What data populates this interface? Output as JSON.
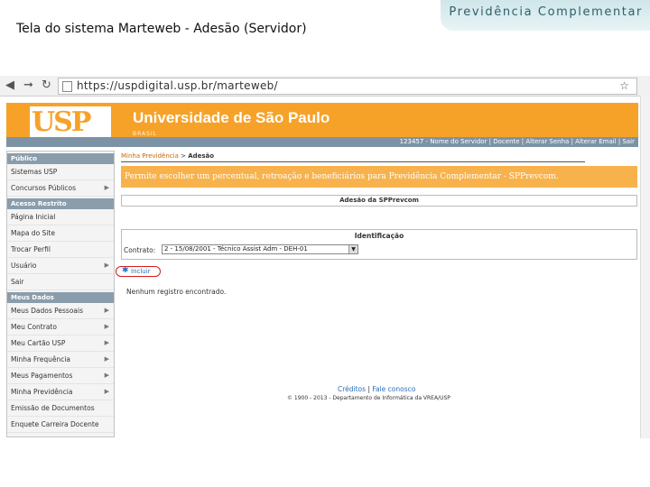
{
  "slide": {
    "banner_title": "Previdência Complementar",
    "title": "Tela do sistema Marteweb - Adesão (Servidor)"
  },
  "browser": {
    "back_icon": "back-arrow-icon",
    "forward_icon": "forward-arrow-icon",
    "reload_icon": "reload-icon",
    "url": "https://uspdigital.usp.br/marteweb/"
  },
  "header": {
    "logo_text": "USP",
    "university_name": "Universidade de São Paulo",
    "country": "BRASIL",
    "user_bar": "123457 - Nome do Servidor | Docente | Alterar Senha | Alterar Email | Sair"
  },
  "sidebar": {
    "sections": [
      {
        "heading": "Público",
        "items": [
          {
            "label": "Sistemas USP",
            "arrow": false
          },
          {
            "label": "Concursos Públicos",
            "arrow": true
          }
        ]
      },
      {
        "heading": "Acesso Restrito",
        "items": [
          {
            "label": "Página Inicial",
            "arrow": false
          },
          {
            "label": "Mapa do Site",
            "arrow": false
          },
          {
            "label": "Trocar Perfil",
            "arrow": false
          },
          {
            "label": "Usuário",
            "arrow": true
          },
          {
            "label": "Sair",
            "arrow": false
          }
        ]
      },
      {
        "heading": "Meus Dados",
        "items": [
          {
            "label": "Meus Dados Pessoais",
            "arrow": true
          },
          {
            "label": "Meu Contrato",
            "arrow": true
          },
          {
            "label": "Meu Cartão USP",
            "arrow": true
          },
          {
            "label": "Minha Frequência",
            "arrow": true
          },
          {
            "label": "Meus Pagamentos",
            "arrow": true
          },
          {
            "label": "Minha Previdência",
            "arrow": true
          },
          {
            "label": "Emissão de Documentos",
            "arrow": false
          },
          {
            "label": "Enquete Carreira Docente",
            "arrow": false
          }
        ]
      }
    ]
  },
  "main": {
    "breadcrumb_link": "Minha Previdência",
    "breadcrumb_sep": " > ",
    "breadcrumb_current": "Adesão",
    "banner_text": "Permite escolher um percentual, retroação e beneficiários para Previdência Complementar - SPPrevcom.",
    "section_title": "Adesão da SPPrevcom",
    "ident_title": "Identificação",
    "contrato_label": "Contrato:",
    "contrato_value": "2 - 15/08/2001 - Técnico Assist Adm - DEH-01",
    "incluir_label": "Incluir",
    "no_records": "Nenhum registro encontrado."
  },
  "footer": {
    "creditos": "Créditos",
    "separator": " | ",
    "fale_conosco": "Fale conosco",
    "copyright": "© 1900 - 2013 - Departamento de Informática da VREA/USP"
  },
  "colors": {
    "usp_orange": "#f6a229",
    "banner_orange": "#f8b24c",
    "nav_gray": "#8a9dac",
    "link_blue": "#2a6fb8",
    "highlight_red": "#d81c1c"
  }
}
